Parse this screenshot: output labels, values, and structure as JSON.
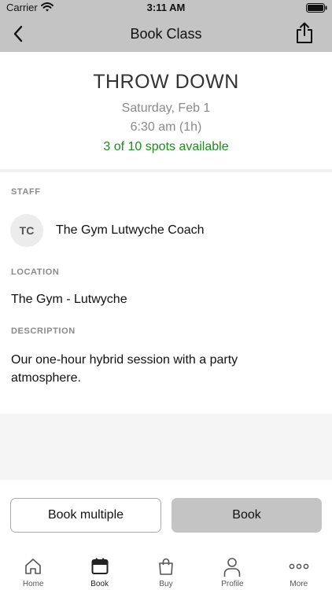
{
  "status_bar": {
    "carrier": "Carrier",
    "time": "3:11 AM"
  },
  "nav": {
    "title": "Book Class"
  },
  "class_info": {
    "title": "THROW DOWN",
    "date": "Saturday, Feb 1",
    "time": "6:30 am (1h)",
    "spots": "3 of 10 spots available"
  },
  "staff": {
    "label": "STAFF",
    "initials": "TC",
    "name": "The Gym Lutwyche Coach"
  },
  "location": {
    "label": "LOCATION",
    "value": "The Gym - Lutwyche"
  },
  "description": {
    "label": "DESCRIPTION",
    "value": "Our one-hour hybrid session with a party atmosphere."
  },
  "actions": {
    "book_multiple": "Book multiple",
    "book": "Book"
  },
  "tabs": [
    {
      "label": "Home",
      "icon": "home-icon"
    },
    {
      "label": "Book",
      "icon": "calendar-icon",
      "active": true
    },
    {
      "label": "Buy",
      "icon": "shopping-bag-icon"
    },
    {
      "label": "Profile",
      "icon": "person-icon"
    },
    {
      "label": "More",
      "icon": "more-dots-icon"
    }
  ],
  "colors": {
    "bar_grey": "#c4c4c4",
    "spots_green": "#1f8a1f",
    "muted_text": "#8a8a8a"
  }
}
